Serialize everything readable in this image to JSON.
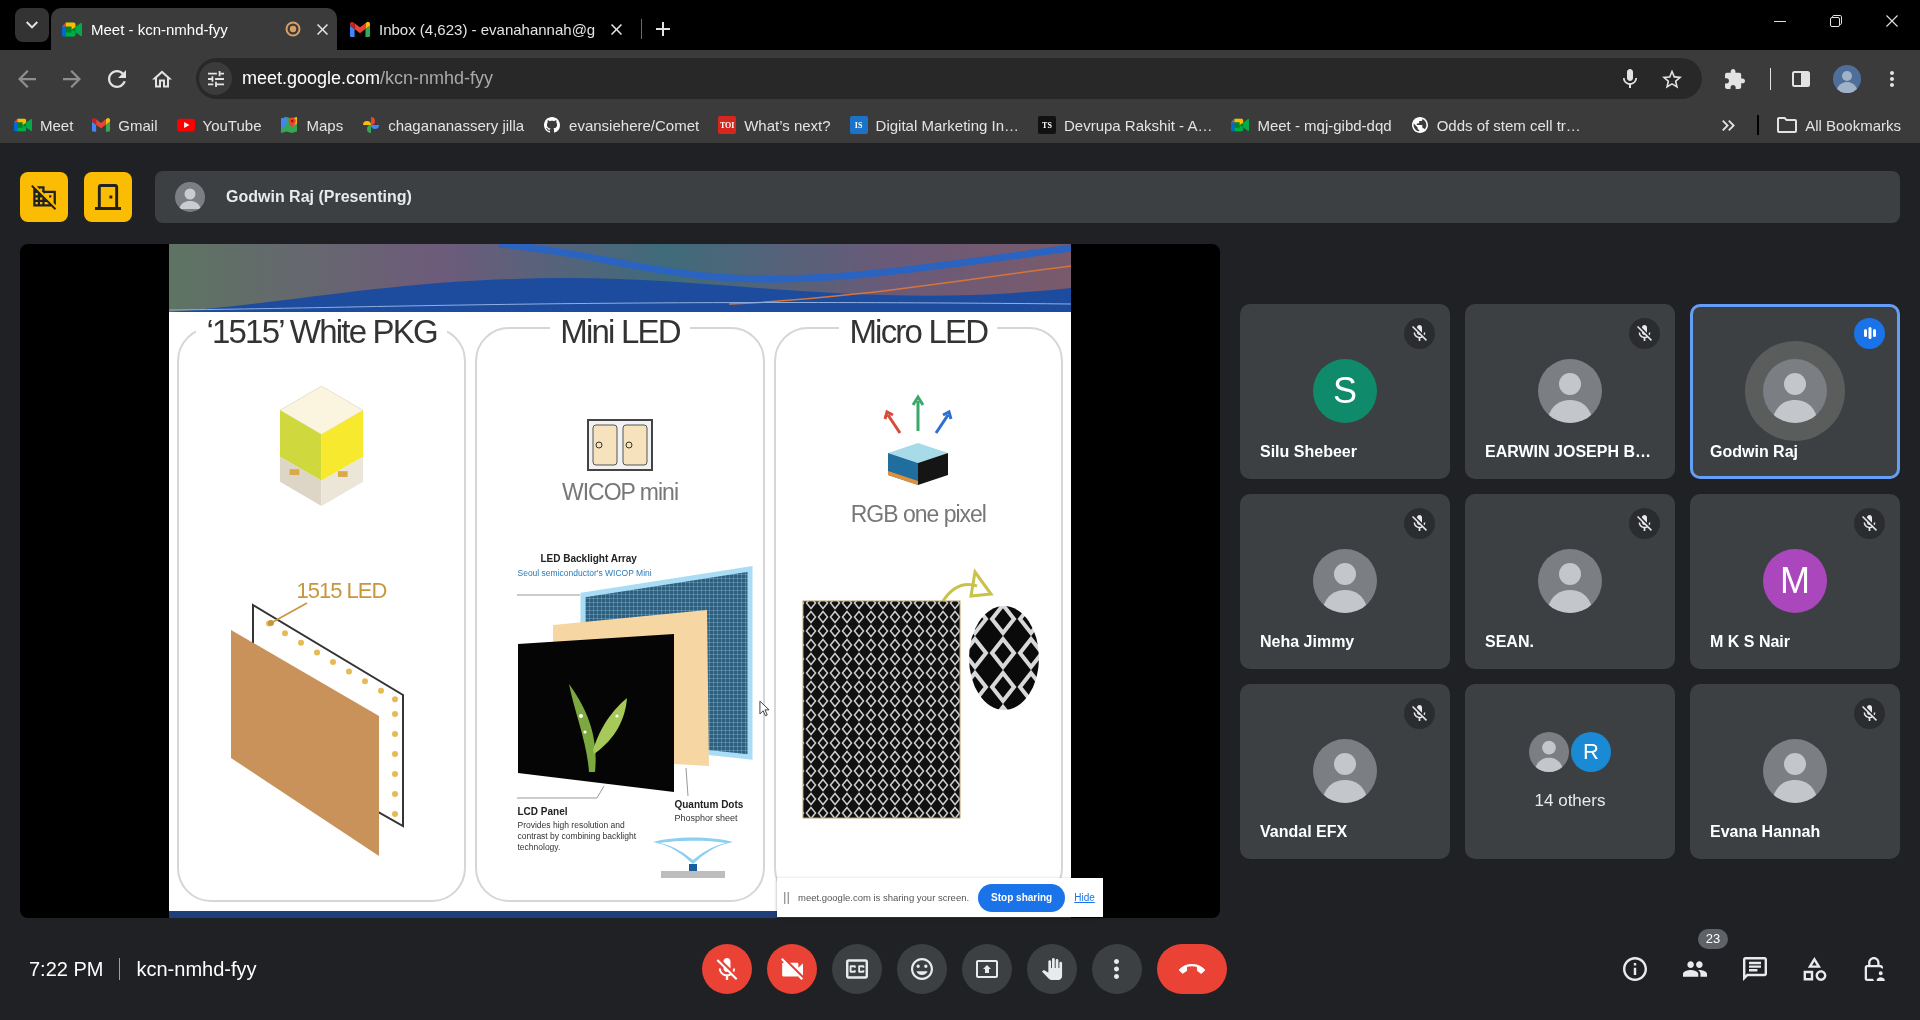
{
  "browser": {
    "tabs": [
      {
        "title": "Meet - kcn-nmhd-fyy",
        "kind": "meet",
        "selected": true,
        "capturing": true
      },
      {
        "title": "Inbox (4,623) - evanahannah@g",
        "kind": "gmail",
        "selected": false,
        "capturing": false
      }
    ],
    "url": {
      "host": "meet.google.com",
      "path": "/kcn-nmhd-fyy"
    },
    "bookmarks": [
      {
        "label": "Meet",
        "kind": "meet"
      },
      {
        "label": "Gmail",
        "kind": "gmail"
      },
      {
        "label": "YouTube",
        "kind": "youtube"
      },
      {
        "label": "Maps",
        "kind": "maps"
      },
      {
        "label": "chagananassery jilla",
        "kind": "photos"
      },
      {
        "label": "evansiehere/Comet",
        "kind": "github"
      },
      {
        "label": "What’s next?",
        "kind": "tile",
        "logo": "TOI",
        "color": "#d7261e"
      },
      {
        "label": "Digital Marketing In…",
        "kind": "tile",
        "logo": "IS",
        "color": "#1a73c8"
      },
      {
        "label": "Devrupa Rakshit - A…",
        "kind": "tile",
        "logo": "TS",
        "color": "#111111"
      },
      {
        "label": "Meet - mqj-gibd-dqd",
        "kind": "meet"
      },
      {
        "label": "Odds of stem cell tr…",
        "kind": "globe"
      }
    ],
    "all_bookmarks": "All Bookmarks"
  },
  "header": {
    "quick_actions": [
      {
        "kind": "building_off"
      },
      {
        "kind": "door"
      }
    ],
    "presenter": "Godwin Raj (Presenting)"
  },
  "slide": {
    "panels": [
      {
        "kind": "package",
        "title": "‘1515’ White PKG",
        "callout": "1515 LED"
      },
      {
        "kind": "mini",
        "title": "Mini LED",
        "caption": "WICOP mini",
        "labels": {
          "array": "LED Backlight Array",
          "array_note": "Seoul semiconductor's WICOP Mini",
          "lcd": "LCD Panel",
          "lcd_note": "Provides high resolution and contrast by combining backlight technology.",
          "qd": "Quantum Dots",
          "qd_note": "Phosphor sheet"
        }
      },
      {
        "kind": "micro",
        "title": "Micro LED",
        "caption": "RGB one pixel"
      }
    ]
  },
  "share_notice": {
    "message": "meet.google.com is sharing your screen.",
    "stop": "Stop sharing",
    "hide": "Hide"
  },
  "participants": [
    {
      "kind": "person",
      "name": "Silu Shebeer",
      "avatar": {
        "kind": "initial",
        "initial": "S",
        "color": "#0f8b6c"
      },
      "muted": true,
      "speaking": false
    },
    {
      "kind": "person",
      "name": "EARWIN JOSEPH B…",
      "avatar": {
        "kind": "photo"
      },
      "muted": true,
      "speaking": false
    },
    {
      "kind": "person",
      "name": "Godwin Raj",
      "avatar": {
        "kind": "photo"
      },
      "muted": false,
      "speaking": true
    },
    {
      "kind": "person",
      "name": "Neha Jimmy",
      "avatar": {
        "kind": "photo"
      },
      "muted": true,
      "speaking": false
    },
    {
      "kind": "person",
      "name": "SEAN.",
      "avatar": {
        "kind": "photo"
      },
      "muted": true,
      "speaking": false
    },
    {
      "kind": "person",
      "name": "M K S Nair",
      "avatar": {
        "kind": "initial",
        "initial": "M",
        "color": "#ab47bc"
      },
      "muted": true,
      "speaking": false
    },
    {
      "kind": "person",
      "name": "Vandal EFX",
      "avatar": {
        "kind": "photo"
      },
      "muted": true,
      "speaking": false
    },
    {
      "kind": "others",
      "label": "14 others",
      "avatars": [
        {
          "kind": "photo"
        },
        {
          "kind": "initial",
          "initial": "R",
          "color": "#1a8ad4"
        }
      ]
    },
    {
      "kind": "person",
      "name": "Evana Hannah",
      "avatar": {
        "kind": "photo"
      },
      "muted": true,
      "speaking": false
    }
  ],
  "bottom_bar": {
    "time": "7:22 PM",
    "meeting_code": "kcn-nmhd-fyy",
    "controls": [
      {
        "kind": "mic",
        "on": false
      },
      {
        "kind": "camera",
        "on": false
      },
      {
        "kind": "captions"
      },
      {
        "kind": "reactions"
      },
      {
        "kind": "present"
      },
      {
        "kind": "hand"
      },
      {
        "kind": "more"
      },
      {
        "kind": "end_call"
      }
    ],
    "side_controls": [
      {
        "kind": "info"
      },
      {
        "kind": "people",
        "badge": "23"
      },
      {
        "kind": "chat"
      },
      {
        "kind": "activities"
      },
      {
        "kind": "host"
      }
    ]
  }
}
